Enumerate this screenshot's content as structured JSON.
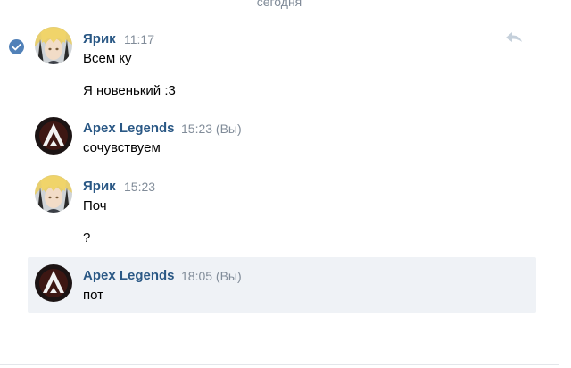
{
  "date_divider": "сегодня",
  "messages": [
    {
      "author": "Ярик",
      "time": "11:17",
      "texts": [
        "Всем ку",
        "Я новенький :3"
      ]
    },
    {
      "author": "Apex Legends",
      "time": "15:23 (Вы)",
      "texts": [
        "сочувствуем"
      ]
    },
    {
      "author": "Ярик",
      "time": "15:23",
      "texts": [
        "Поч",
        "?"
      ]
    },
    {
      "author": "Apex Legends",
      "time": "18:05 (Вы)",
      "texts": [
        "пот"
      ]
    }
  ],
  "icons": {
    "selected": "checkmark-icon",
    "reply": "reply-icon"
  },
  "colors": {
    "author": "#2a5885",
    "meta": "#818c99",
    "highlight": "#eff2f6",
    "check": "#5181b8"
  }
}
